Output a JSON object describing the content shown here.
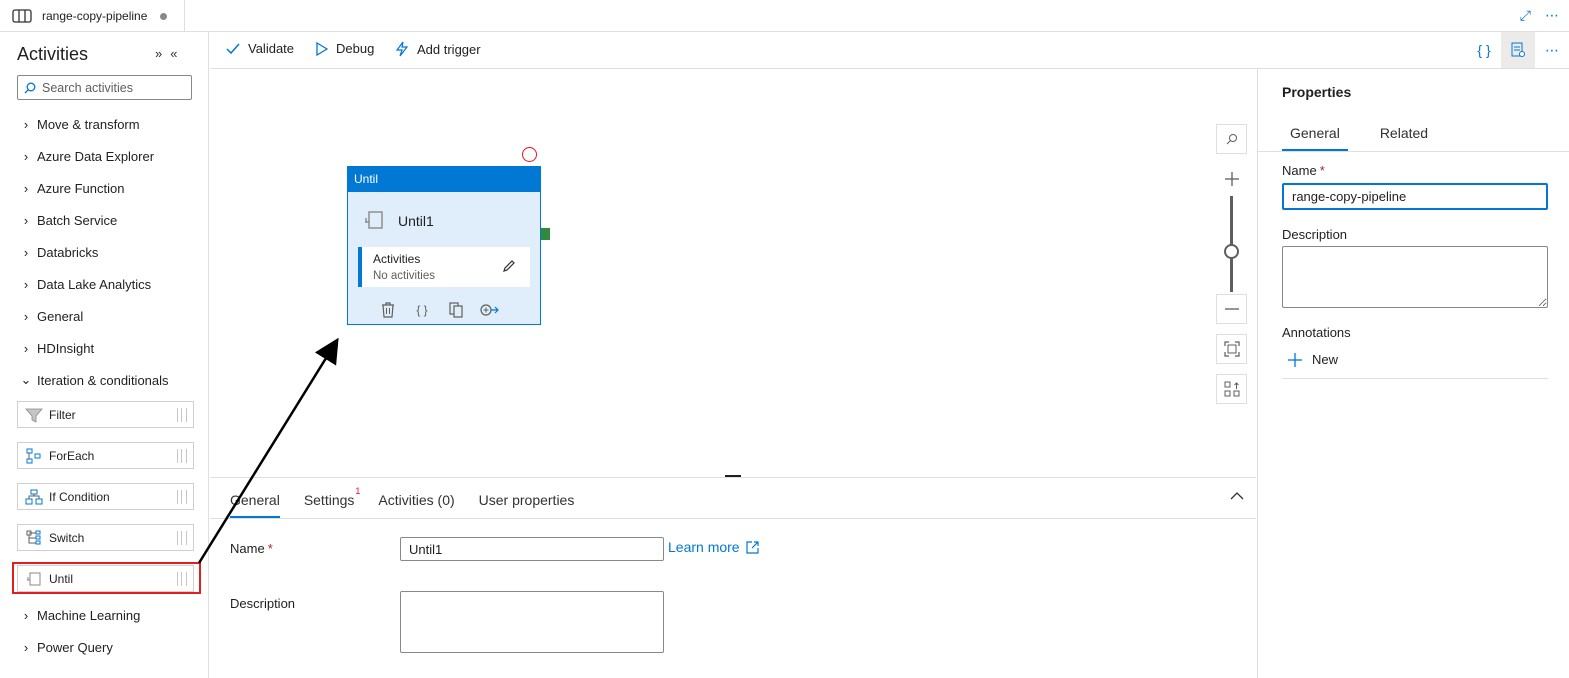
{
  "tab": {
    "title": "range-copy-pipeline"
  },
  "activities": {
    "title": "Activities",
    "search_placeholder": "Search activities",
    "categories": [
      "Move & transform",
      "Azure Data Explorer",
      "Azure Function",
      "Batch Service",
      "Databricks",
      "Data Lake Analytics",
      "General",
      "HDInsight",
      "Iteration & conditionals",
      "Machine Learning",
      "Power Query"
    ],
    "iteration_items": [
      "Filter",
      "ForEach",
      "If Condition",
      "Switch",
      "Until"
    ]
  },
  "toolbar": {
    "validate": "Validate",
    "debug": "Debug",
    "add_trigger": "Add trigger"
  },
  "node": {
    "type": "Until",
    "name": "Until1",
    "inner_title": "Activities",
    "inner_sub": "No activities"
  },
  "bottom": {
    "tabs": [
      "General",
      "Settings",
      "Activities (0)",
      "User properties"
    ],
    "settings_badge": "1",
    "name_label": "Name",
    "name_value": "Until1",
    "learn_more": "Learn more",
    "description_label": "Description"
  },
  "properties": {
    "title": "Properties",
    "tabs": [
      "General",
      "Related"
    ],
    "name_label": "Name",
    "name_value": "range-copy-pipeline",
    "description_label": "Description",
    "annotations_label": "Annotations",
    "new_label": "New"
  },
  "colors": {
    "accent": "#0078d4",
    "highlight": "#e02020",
    "success": "#2f8a3e",
    "error": "#e81123"
  }
}
